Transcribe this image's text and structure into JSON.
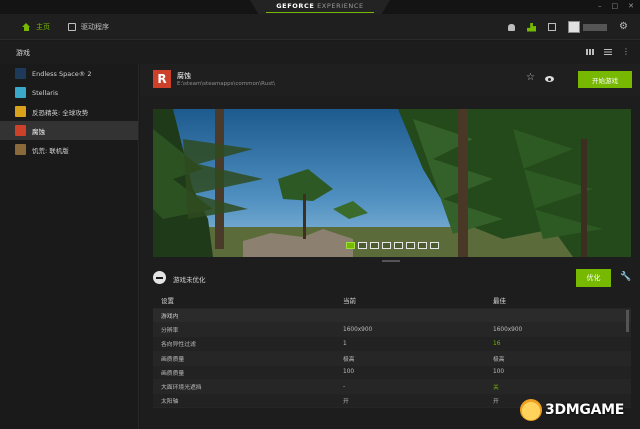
{
  "titlebar": {
    "brand": "GEFORCE",
    "brand_suffix": "EXPERIENCE",
    "minimize": "–",
    "maximize": "□",
    "close": "✕"
  },
  "nav": {
    "home_label": "主页",
    "drivers_label": "驱动程序",
    "icons": [
      "bell-icon",
      "share-icon",
      "grid-icon",
      "gear-icon"
    ]
  },
  "section": {
    "title": "游戏"
  },
  "sidebar": {
    "items": [
      {
        "label": "Endless Space® 2",
        "color": "#1e3a5a"
      },
      {
        "label": "Stellaris",
        "color": "#3aa8c8"
      },
      {
        "label": "反恐精英: 全球攻势",
        "color": "#d9a21c"
      },
      {
        "label": "腐蚀",
        "color": "#cd412b",
        "selected": true
      },
      {
        "label": "饥荒: 联机版",
        "color": "#8a6a3a"
      }
    ]
  },
  "game": {
    "logo_letter": "R",
    "name": "腐蚀",
    "path": "E:\\steam\\steamapps\\common\\Rust\\",
    "play_label": "开始游戏"
  },
  "carousel": {
    "count": 8,
    "active_index": 0
  },
  "optimize": {
    "status": "游戏未优化",
    "button_label": "优化"
  },
  "table": {
    "headers": {
      "setting": "设置",
      "current": "当前",
      "optimal": "最佳"
    },
    "group": "游戏内",
    "rows": [
      {
        "setting": "分辨率",
        "current": "1600x900",
        "optimal": "1600x900",
        "highlight": false
      },
      {
        "setting": "各向异性过滤",
        "current": "1",
        "optimal": "16",
        "highlight": true
      },
      {
        "setting": "画质质量",
        "current": "极高",
        "optimal": "极高",
        "highlight": false
      },
      {
        "setting": "画质质量",
        "current": "100",
        "optimal": "100",
        "highlight": false
      },
      {
        "setting": "大面环境光遮挡",
        "current": "-",
        "optimal": "关",
        "highlight": true
      },
      {
        "setting": "太阳轴",
        "current": "开",
        "optimal": "开",
        "highlight": false
      }
    ]
  },
  "watermark": {
    "text": "3DMGAME"
  },
  "colors": {
    "accent": "#76b900",
    "panel": "#1d1d1d"
  }
}
